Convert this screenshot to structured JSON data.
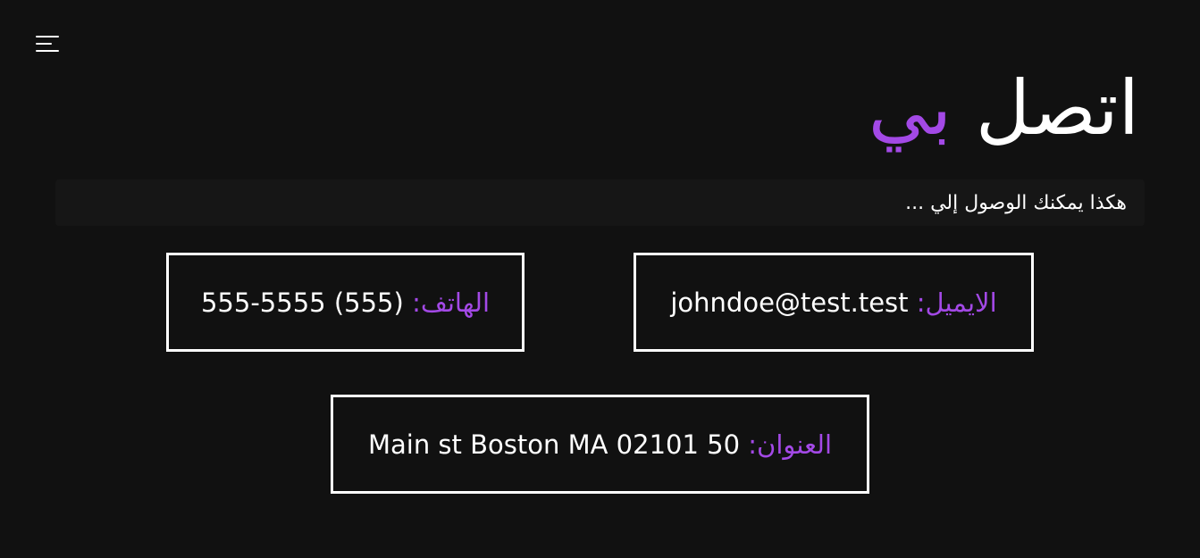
{
  "header": {
    "menu_icon": "hamburger-menu-icon",
    "title_main": "اتصل",
    "title_accent": "بي",
    "subtitle": "هكذا يمكنك الوصول إلي ..."
  },
  "contacts": {
    "email": {
      "label": "الايميل:",
      "value": "johndoe@test.test"
    },
    "phone": {
      "label": "الهاتف:",
      "value": "(555) 555-5555"
    },
    "address": {
      "label": "العنوان:",
      "value": "50 Main st Boston MA 02101"
    }
  },
  "colors": {
    "background": "#111111",
    "accent": "#a349e6",
    "text": "#ffffff",
    "border": "#ffffff"
  }
}
